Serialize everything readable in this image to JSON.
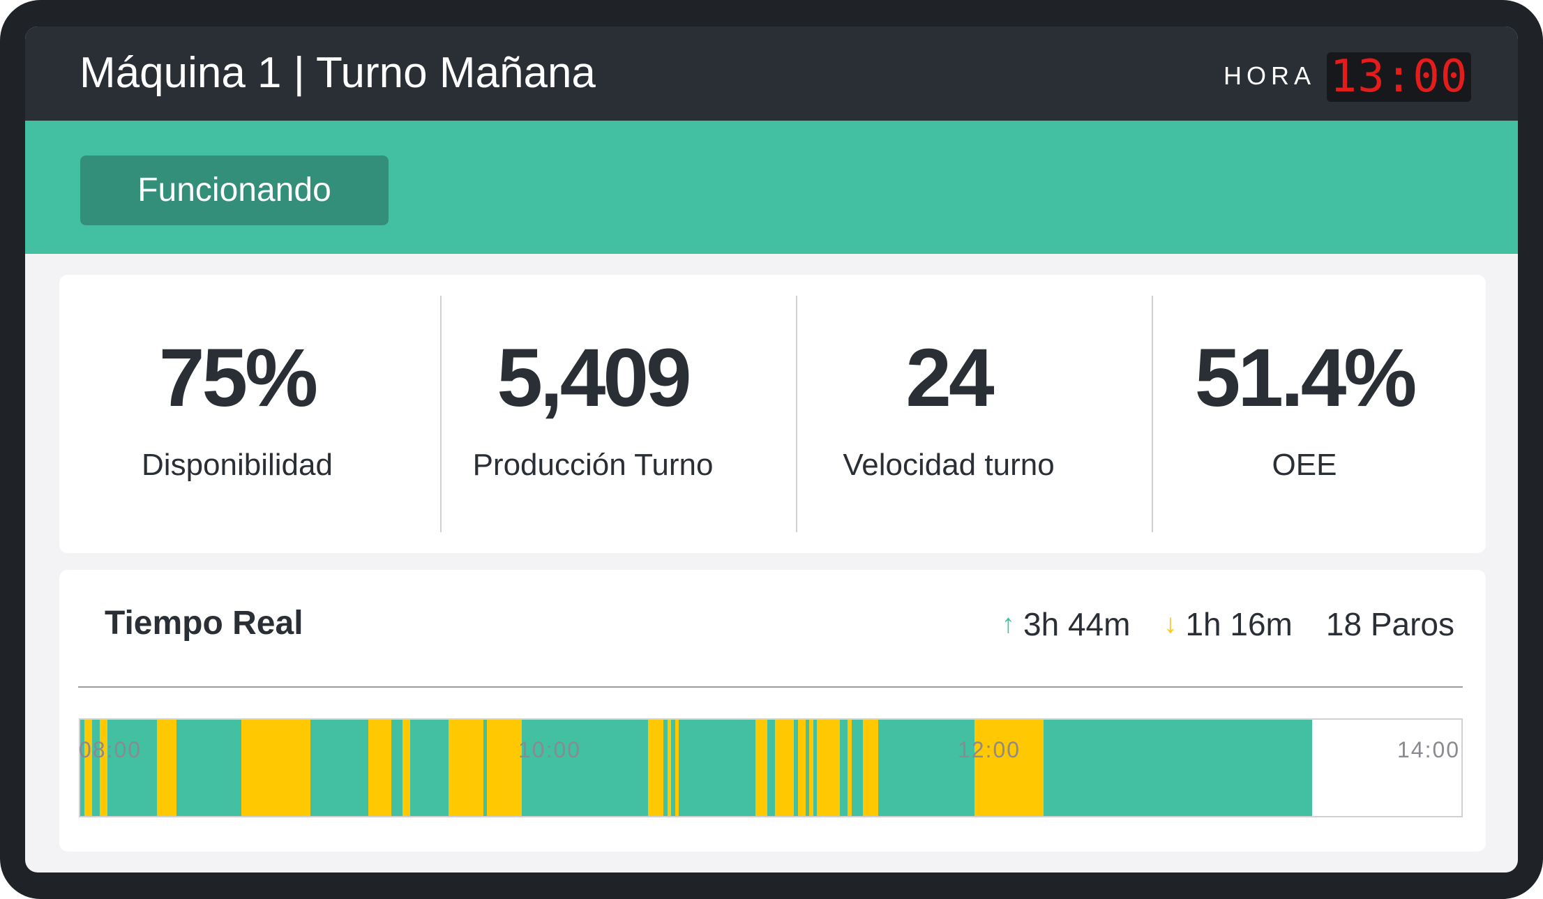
{
  "header": {
    "title": "Máquina 1 | Turno Mañana",
    "hora_label": "HORA",
    "clock": "13:00"
  },
  "status": {
    "label": "Funcionando",
    "color": "#43c0a2"
  },
  "kpis": [
    {
      "value": "75%",
      "label": "Disponibilidad"
    },
    {
      "value": "5,409",
      "label": "Producción Turno"
    },
    {
      "value": "24",
      "label": "Velocidad turno"
    },
    {
      "value": "51.4%",
      "label": "OEE"
    }
  ],
  "realtime": {
    "title": "Tiempo Real",
    "uptime": "3h 44m",
    "downtime": "1h 16m",
    "stops": "18 Paros",
    "colors": {
      "running": "#43c0a2",
      "stopped": "#ffc800",
      "idle": "#ffffff"
    },
    "axis_ticks": [
      "08:00",
      "10:00",
      "12:00",
      "14:00"
    ],
    "timeline_start": "08:00",
    "timeline_end": "14:00",
    "stop_intervals": [
      [
        "08:01",
        "08:03"
      ],
      [
        "08:05",
        "08:07"
      ],
      [
        "08:20",
        "08:25"
      ],
      [
        "08:42",
        "09:00"
      ],
      [
        "09:15",
        "09:21"
      ],
      [
        "09:24",
        "09:26"
      ],
      [
        "09:36",
        "09:45"
      ],
      [
        "09:46",
        "09:55"
      ],
      [
        "10:28",
        "10:32"
      ],
      [
        "10:33",
        "10:34"
      ],
      [
        "10:35",
        "10:36"
      ],
      [
        "10:56",
        "10:59"
      ],
      [
        "11:01",
        "11:06"
      ],
      [
        "11:07",
        "11:09"
      ],
      [
        "11:10",
        "11:11"
      ],
      [
        "11:12",
        "11:18"
      ],
      [
        "11:20",
        "11:21"
      ],
      [
        "11:24",
        "11:28"
      ],
      [
        "11:53",
        "12:11"
      ]
    ],
    "running_until": "13:21"
  }
}
